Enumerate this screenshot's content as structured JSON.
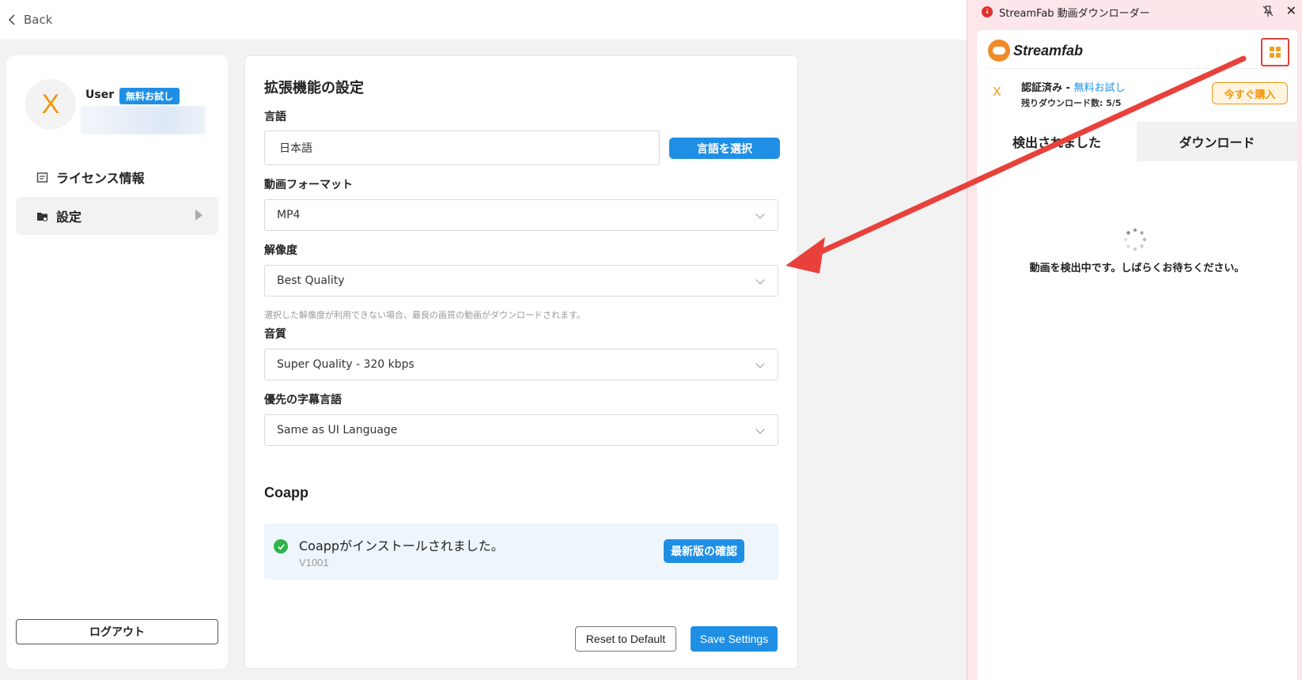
{
  "topbar": {
    "back_label": "Back"
  },
  "sidebar": {
    "avatar_letter": "X",
    "user_name": "User",
    "user_badge": "無料お試し",
    "items": [
      {
        "label": "ライセンス情報",
        "icon": "license-icon"
      },
      {
        "label": "設定",
        "icon": "folder-settings-icon",
        "active": true
      }
    ],
    "logout_label": "ログアウト"
  },
  "main": {
    "title": "拡張機能の設定",
    "language": {
      "label": "言語",
      "value": "日本語",
      "button": "言語を選択"
    },
    "video_format": {
      "label": "動画フォーマット",
      "value": "MP4"
    },
    "resolution": {
      "label": "解像度",
      "value": "Best Quality",
      "hint": "選択した解像度が利用できない場合、最良の画質の動画がダウンロードされます。"
    },
    "audio": {
      "label": "音質",
      "value": "Super Quality - 320 kbps"
    },
    "subtitle": {
      "label": "優先の字幕言語",
      "value": "Same as UI Language"
    },
    "coapp": {
      "title": "Coapp",
      "status": "Coappがインストールされました。",
      "version": "V1001",
      "check_button": "最新版の確認"
    },
    "reset_label": "Reset to Default",
    "save_label": "Save Settings"
  },
  "extension": {
    "window_title": "StreamFab 動画ダウンローダー",
    "logo_text": "Streamfab",
    "status_letter": "X",
    "auth_label": "認証済み - ",
    "auth_trial": "無料お試し",
    "remaining": "残りダウンロード数: 5/5",
    "buy_label": "今すぐ購入",
    "tabs": [
      "検出されました",
      "ダウンロード"
    ],
    "detecting_text": "動画を検出中です。しばらくお待ちください。"
  },
  "colors": {
    "accent": "#1f8fe5",
    "brand_orange": "#f0960c",
    "arrow": "#e8413b",
    "panel_bg": "#fde6ea"
  }
}
